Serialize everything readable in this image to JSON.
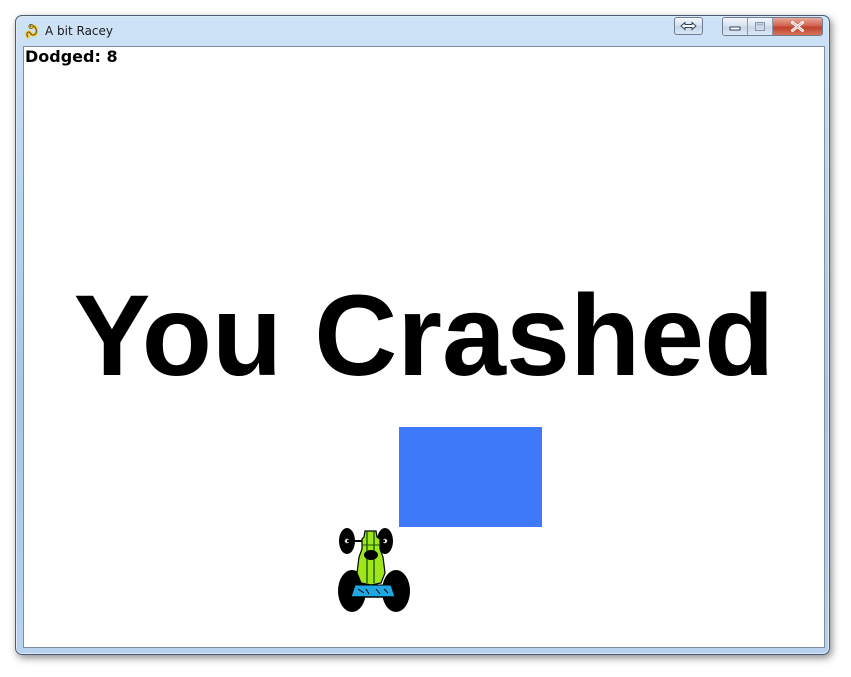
{
  "window": {
    "title": "A bit Racey",
    "icon": "pygame-snake-icon",
    "controls": [
      "resize-toggle-icon",
      "minimize-icon",
      "maximize-icon",
      "close-icon"
    ]
  },
  "game": {
    "score_label": "Dodged: 8",
    "dodged": 8,
    "message": "You Crashed",
    "block_color": "#3d79f8",
    "car_color": "#9ee61a",
    "background_color": "#ffffff"
  }
}
